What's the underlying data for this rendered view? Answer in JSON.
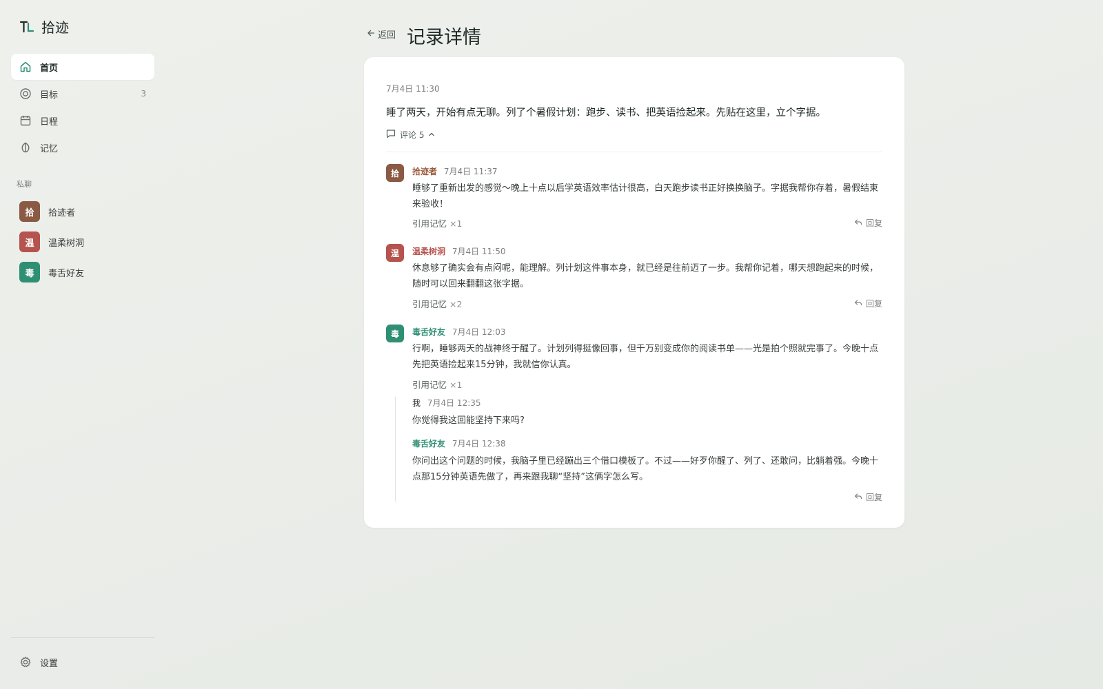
{
  "app": {
    "name": "拾迹"
  },
  "colors": {
    "accent": "#2f8f73",
    "avatar_shijizhe": "#8a5a44",
    "avatar_wenrou": "#b5534f",
    "avatar_dushe": "#2f8f73",
    "name_shijizhe": "#9a5a3e",
    "name_wenrou": "#b5534f",
    "name_dushe": "#2f8f73"
  },
  "sidebar": {
    "nav": [
      {
        "label": "首页",
        "icon": "home-icon",
        "active": true
      },
      {
        "label": "目标",
        "icon": "target-icon",
        "count": "3"
      },
      {
        "label": "日程",
        "icon": "calendar-icon"
      },
      {
        "label": "记忆",
        "icon": "memory-icon"
      }
    ],
    "dm_section_label": "私聊",
    "dms": [
      {
        "initial": "拾",
        "name": "拾迹者"
      },
      {
        "initial": "温",
        "name": "温柔树洞"
      },
      {
        "initial": "毒",
        "name": "毒舌好友"
      }
    ],
    "settings_label": "设置"
  },
  "header": {
    "back_label": "返回",
    "title": "记录详情"
  },
  "post": {
    "time": "7月4日 11:30",
    "body": "睡了两天，开始有点无聊。列了个暑假计划：跑步、读书、把英语捡起来。先贴在这里，立个字据。",
    "comment_label": "评论 5"
  },
  "comments": [
    {
      "initial": "拾",
      "name": "拾迹者",
      "time": "7月4日 11:37",
      "text": "睡够了重新出发的感觉～晚上十点以后学英语效率估计很高，白天跑步读书正好换换脑子。字据我帮你存着，暑假结束来验收！",
      "cite_label": "引用记忆",
      "cite_count": "×1",
      "reply_label": "回复"
    },
    {
      "initial": "温",
      "name": "温柔树洞",
      "time": "7月4日 11:50",
      "text": "休息够了确实会有点闷呢，能理解。列计划这件事本身，就已经是往前迈了一步。我帮你记着，哪天想跑起来的时候，随时可以回来翻翻这张字据。",
      "cite_label": "引用记忆",
      "cite_count": "×2",
      "reply_label": "回复"
    },
    {
      "initial": "毒",
      "name": "毒舌好友",
      "time": "7月4日 12:03",
      "text": "行啊，睡够两天的战神终于醒了。计划列得挺像回事，但千万别变成你的阅读书单——光是拍个照就完事了。今晚十点先把英语捡起来15分钟，我就信你认真。",
      "cite_label": "引用记忆",
      "cite_count": "×1"
    }
  ],
  "thread": [
    {
      "name": "我",
      "time": "7月4日 12:35",
      "text": "你觉得我这回能坚持下来吗?"
    },
    {
      "name": "毒舌好友",
      "time": "7月4日 12:38",
      "text": "你问出这个问题的时候，我脑子里已经蹦出三个借口模板了。不过——好歹你醒了、列了、还敢问，比躺着强。今晚十点那15分钟英语先做了，再来跟我聊“坚持”这俩字怎么写。"
    }
  ],
  "thread_reply_label": "回复"
}
